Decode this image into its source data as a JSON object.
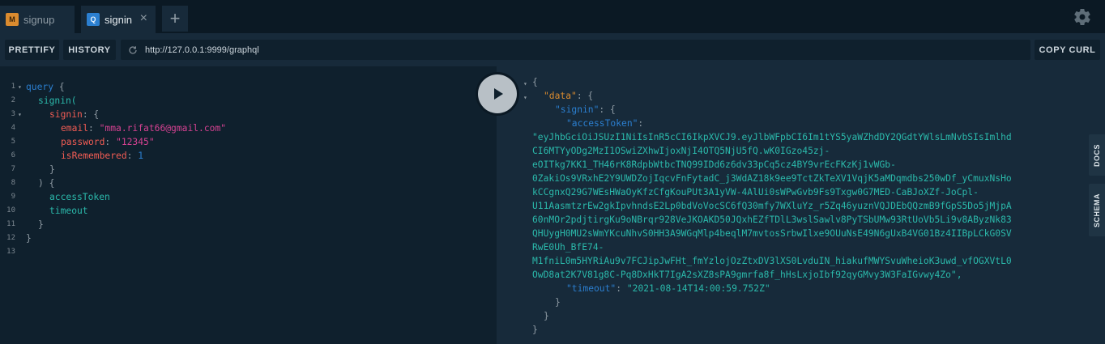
{
  "tabs": [
    {
      "badge": "M",
      "label": "signup"
    },
    {
      "badge": "Q",
      "label": "signin",
      "close": "×"
    }
  ],
  "add_tab": "+",
  "toolbar": {
    "prettify": "PRETTIFY",
    "history": "HISTORY",
    "url": "http://127.0.0.1:9999/graphql",
    "copy_curl": "COPY CURL"
  },
  "editor": {
    "line_numbers": [
      "1",
      "2",
      "3",
      "4",
      "5",
      "6",
      "7",
      "8",
      "9",
      "10",
      "11",
      "12",
      "13"
    ],
    "query_kw": "query",
    "l1_brace": "{",
    "signin_call": "signin(",
    "signin_arg": "signin",
    "colon_brace": ": {",
    "email_key": "email",
    "email_val": "\"mma.rifat66@gmail.com\"",
    "password_key": "password",
    "password_val": "\"12345\"",
    "remembered_key": "isRemembered",
    "remembered_val": "1",
    "colon": ": ",
    "close_brace": "}",
    "close_paren_brace": ") {",
    "field_access": "accessToken",
    "field_timeout": "timeout"
  },
  "results": {
    "open": "{",
    "data_key": "\"data\"",
    "signin_key": "\"signin\"",
    "colon_brace": ": {",
    "token_key": "\"accessToken\"",
    "colon": ":",
    "token_lines": [
      "\"eyJhbGciOiJSUzI1NiIsInR5cCI6IkpXVCJ9.eyJlbWFpbCI6Im1tYS5yaWZhdDY2QGdtYWlsLmNvbSIsImlhd",
      "CI6MTYyODg2MzI1OSwiZXhwIjoxNjI4OTQ5NjU5fQ.wK0IGzo45zj-",
      "eOITkg7KK1_TH46rK8RdpbWtbcTNQ99IDd6z6dv33pCq5cz4BY9vrEcFKzKj1vWGb-",
      "0ZakiOs9VRxhE2Y9UWDZojIqcvFnFytadC_j3WdAZ18k9ee9TctZkTeXV1VqjK5aMDqmdbs250wDf_yCmuxNsHo",
      "kCCgnxQ29G7WEsHWaOyKfzCfgKouPUt3A1yVW-4AlUi0sWPwGvb9Fs9Txgw0G7MED-CaBJoXZf-JoCpl-",
      "U11AasmtzrEw2gkIpvhndsE2Lp0bdVoVocSC6fQ30mfy7WXluYz_r5Zq46yuznVQJDEbQQzmB9fGpS5Do5jMjpA",
      "60nMOr2pdjtirgKu9oNBrqr928VeJKOAKD50JQxhEZfTDlL3wslSawlv8PyTSbUMw93RtUoVb5Li9v8AByzNk83",
      "QHUygH0MU2sWmYKcuNhvS0HH3A9WGqMlp4beqlM7mvtosSrbwIlxe9OUuNsE49N6gUxB4VG01Bz4IIBpLCkG0SV",
      "RwE0Uh_BfE74-",
      "M1fniL0m5HYRiAu9v7FCJipJwFHt_fmYzlojOzZtxDV3lXS0LvduIN_hiakufMWYSvuWheioK3uwd_vfOGXVtL0",
      "OwD8at2K7V81g8C-Pq8DxHkT7IgA2sXZ8sPA9gmrfa8f_hHsLxjoIbf92qyGMvy3W3FaIGvwy4Zo\","
    ],
    "timeout_key": "\"timeout\"",
    "timeout_val": "\"2021-08-14T14:00:59.752Z\"",
    "close": "}"
  },
  "side_tabs": {
    "docs": "DOCS",
    "schema": "SCHEMA"
  },
  "colors": {
    "keyword": "#2b7fd0",
    "field": "#2bb9ab",
    "argument": "#f25c54",
    "string": "#d64292",
    "result_key": "#da8b2f"
  }
}
